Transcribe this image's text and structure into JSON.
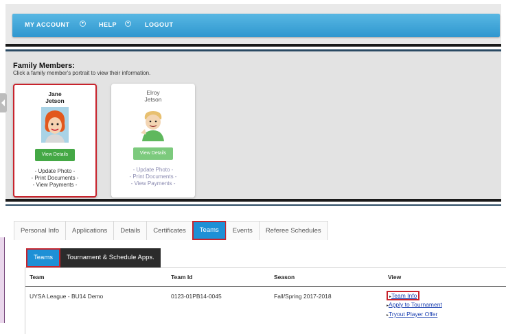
{
  "topnav": {
    "items": [
      "MY ACCOUNT",
      "HELP",
      "LOGOUT"
    ]
  },
  "family": {
    "title": "Family Members:",
    "subtitle": "Click a family member's portrait to view their information.",
    "members": [
      {
        "first": "Jane",
        "last": "Jetson",
        "button": "View Details",
        "links": [
          "- Update Photo -",
          "- Print Documents -",
          "- View Payments -"
        ]
      },
      {
        "first": "Elroy",
        "last": "Jetson",
        "button": "View Details",
        "links": [
          "- Update Photo -",
          "- Print Documents -",
          "- View Payments -"
        ]
      }
    ]
  },
  "tabs": [
    "Personal Info",
    "Applications",
    "Details",
    "Certificates",
    "Teams",
    "Events",
    "Referee Schedules"
  ],
  "active_tab": "Teams",
  "subtabs": [
    "Teams",
    "Tournament & Schedule Apps."
  ],
  "table": {
    "headers": [
      "Team",
      "Team Id",
      "Season",
      "View"
    ],
    "rows": [
      {
        "team": "UYSA League - BU14 Demo",
        "team_id": "0123-01PB14-0045",
        "season": "Fall/Spring 2017-2018",
        "links": [
          "Team Info",
          "Apply to Tournament",
          "Tryout Player Offer"
        ]
      }
    ]
  },
  "colors": {
    "nav_blue": "#2f97cf",
    "active_tab": "#1e90d6",
    "highlight_red": "#c8232c",
    "button_green": "#44a845"
  }
}
